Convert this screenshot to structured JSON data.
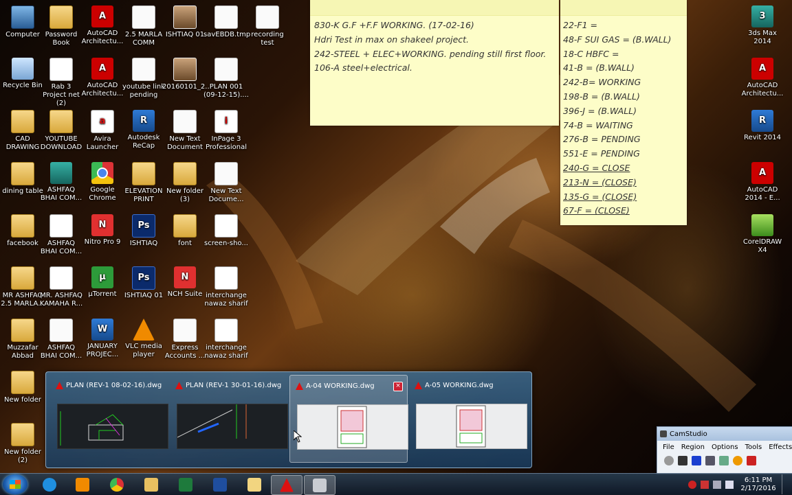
{
  "desktop": {
    "icons_col1": [
      "Computer",
      "Recycle Bin",
      "CAD DRAWING",
      "dining table",
      "facebook",
      "MR ASHFAQ 2.5 MARLA...",
      "Muzzafar Abbad",
      "New folder",
      "New folder (2)"
    ],
    "icons_col2": [
      "Password Book",
      "Rab 3 Project net (2)",
      "YOUTUBE DOWNLOAD",
      "ASHFAQ BHAI COM...",
      "ASHFAQ BHAI COM...",
      "MR. ASHFAQ KAMAHA R...",
      "ASHFAQ BHAI COM..."
    ],
    "icons_col3": [
      "AutoCAD Architectu...",
      "AutoCAD Architectu...",
      "Avira Launcher",
      "Google Chrome",
      "Nitro Pro 9",
      "µTorrent",
      "JANUARY PROJEC..."
    ],
    "icons_col4": [
      "2.5 MARLA COMM",
      "youtube link pending",
      "Autodesk ReCap",
      "ELEVATION PRINT",
      "ISHTIAQ",
      "ISHTIAQ 01",
      "VLC media player"
    ],
    "icons_col5": [
      "ISHTIAQ 01",
      "20160101_2...",
      "New Text Document",
      "New folder (3)",
      "font",
      "NCH Suite",
      "Express Accounts ..."
    ],
    "icons_col6": [
      "savEBDB.tmp",
      "PLAN 001 (09-12-15)....",
      "InPage 3 Professional",
      "New Text Docume...",
      "screen-sho...",
      "interchange nawaz sharif",
      "interchange nawaz sharif"
    ],
    "icons_col7": [
      "recording test"
    ],
    "icons_right": [
      "3ds Max 2014",
      "AutoCAD Architectu...",
      "Revit 2014",
      "AutoCAD 2014 - E...",
      "CorelDRAW X4"
    ]
  },
  "sticky_left": {
    "lines": [
      "830-K G.F +F.F WORKING. (17-02-16)",
      "Hdri Test in max on shakeel project.",
      "242-STEEL + ELEC+WORKING. pending still first floor.",
      "106-A steel+electrical."
    ]
  },
  "sticky_right": {
    "lines": [
      "22-F1 =",
      "48-F SUI GAS = (B.WALL)",
      "18-C HBFC =",
      "41-B = (B.WALL)",
      "242-B= WORKING",
      "198-B = (B.WALL)",
      "396-J = (B.WALL)",
      "74-B = WAITING",
      "276-B = PENDING",
      "551-E = PENDING",
      "240-G = CLOSE",
      "213-N = (CLOSE)",
      "135-G = (CLOSE)",
      "67-F = (CLOSE)"
    ]
  },
  "thumbnails": [
    {
      "title": "PLAN   (REV-1  08-02-16).dwg",
      "style": "dark"
    },
    {
      "title": "PLAN   (REV-1  30-01-16).dwg",
      "style": "dark"
    },
    {
      "title": "A-04 WORKING.dwg",
      "style": "light",
      "close": "×"
    },
    {
      "title": "A-05 WORKING.dwg",
      "style": "light"
    }
  ],
  "taskbar": {
    "apps": [
      "start",
      "internet-explorer",
      "media-player",
      "chrome",
      "file-explorer",
      "excel",
      "word",
      "folder",
      "autocad",
      "camstudio"
    ],
    "clock_time": "6:11 PM",
    "clock_date": "2/17/2016"
  },
  "camstudio": {
    "title": "CamStudio",
    "menu": [
      "File",
      "Region",
      "Options",
      "Tools",
      "Effects"
    ]
  },
  "colors": {
    "sticky_bg": "#fdfdc8",
    "taskbar": "#1a2a3c",
    "autocad_red": "#d11111"
  }
}
